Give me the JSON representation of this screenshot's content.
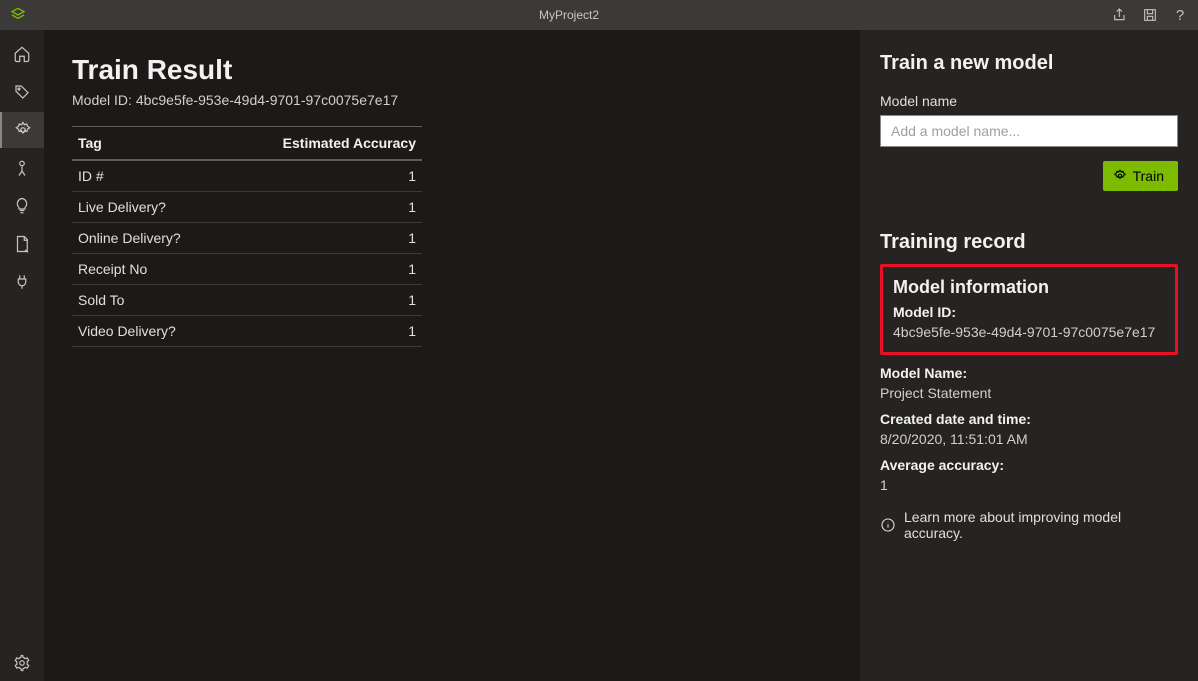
{
  "titlebar": {
    "project": "MyProject2"
  },
  "sidebar": {
    "items": [
      {
        "name": "home-icon"
      },
      {
        "name": "tag-icon"
      },
      {
        "name": "gear-badge-icon",
        "active": true
      },
      {
        "name": "person-icon"
      },
      {
        "name": "lightbulb-icon"
      },
      {
        "name": "document-icon"
      },
      {
        "name": "plug-icon"
      }
    ],
    "bottom": {
      "name": "settings-icon"
    }
  },
  "main": {
    "title": "Train Result",
    "model_id_prefix": "Model ID: ",
    "model_id": "4bc9e5fe-953e-49d4-9701-97c0075e7e17",
    "table": {
      "headers": [
        "Tag",
        "Estimated Accuracy"
      ],
      "rows": [
        {
          "tag": "ID #",
          "accuracy": "1"
        },
        {
          "tag": "Live Delivery?",
          "accuracy": "1"
        },
        {
          "tag": "Online Delivery?",
          "accuracy": "1"
        },
        {
          "tag": "Receipt No",
          "accuracy": "1"
        },
        {
          "tag": "Sold To",
          "accuracy": "1"
        },
        {
          "tag": "Video Delivery?",
          "accuracy": "1"
        }
      ]
    }
  },
  "panel": {
    "train_title": "Train a new model",
    "model_name_label": "Model name",
    "model_name_placeholder": "Add a model name...",
    "train_button": "Train",
    "record_title": "Training record",
    "info_title": "Model information",
    "fields": {
      "model_id_label": "Model ID:",
      "model_id_value": "4bc9e5fe-953e-49d4-9701-97c0075e7e17",
      "model_name_label": "Model Name:",
      "model_name_value": "Project Statement",
      "created_label": "Created date and time:",
      "created_value": "8/20/2020, 11:51:01 AM",
      "avg_acc_label": "Average accuracy:",
      "avg_acc_value": "1"
    },
    "learn_more": "Learn more about improving model accuracy."
  }
}
